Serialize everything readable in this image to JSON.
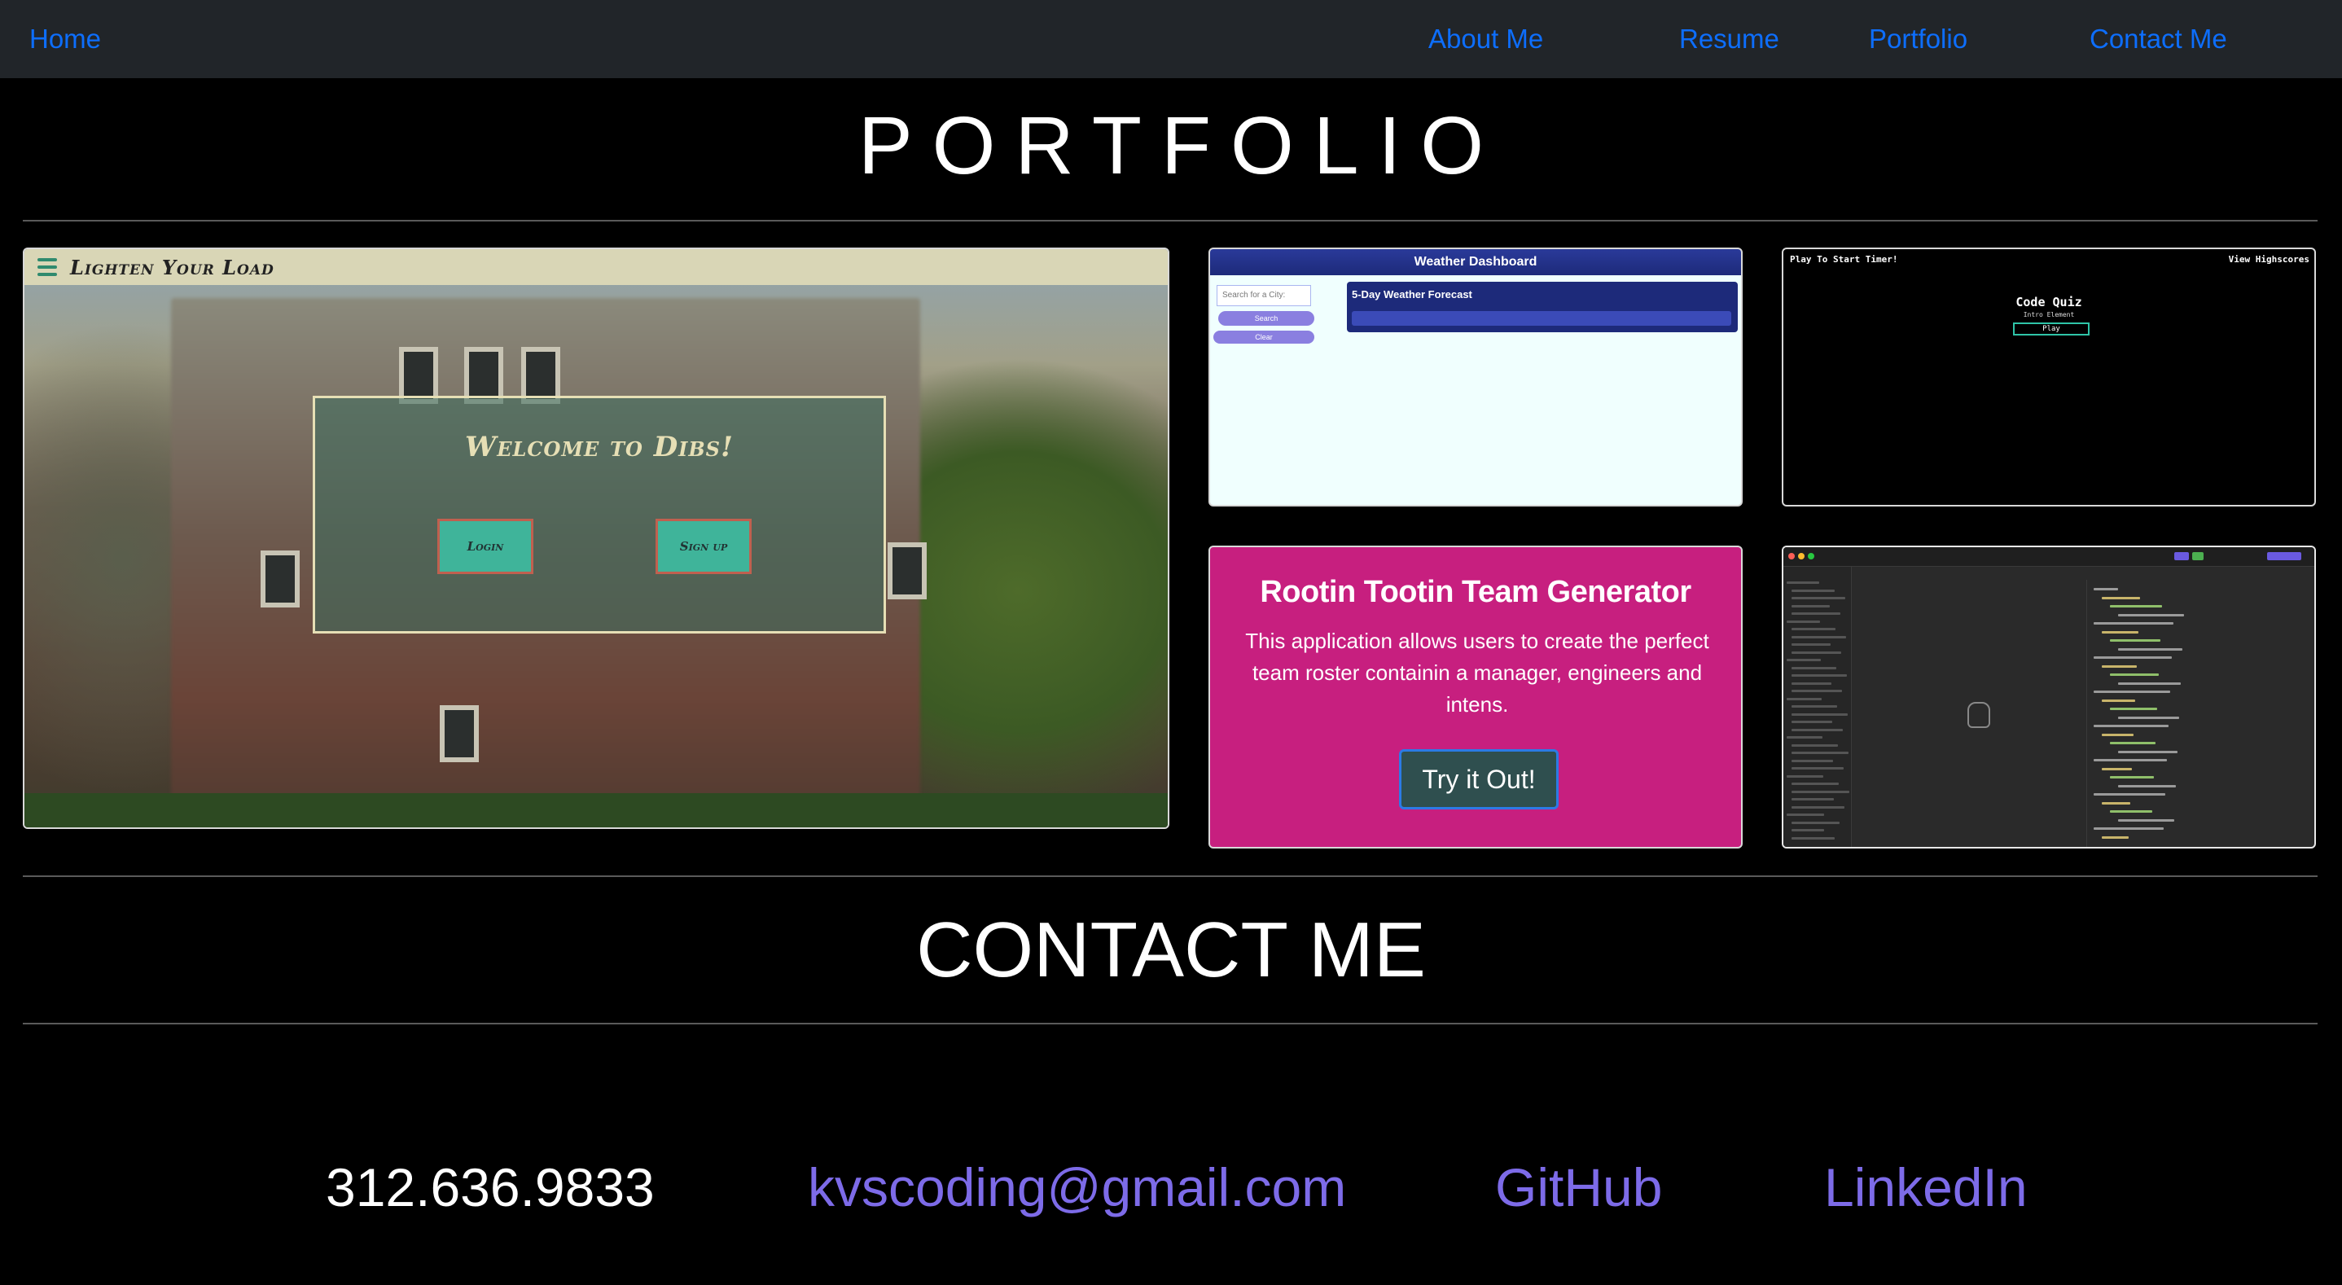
{
  "nav": {
    "home": "Home",
    "about": "About Me",
    "resume": "Resume",
    "portfolio": "Portfolio",
    "contact": "Contact Me"
  },
  "portfolio": {
    "title": "PORTFOLIO",
    "dibs": {
      "brand": "Lighten Your Load",
      "welcome": "Welcome to Dibs!",
      "login": "Login",
      "signup": "Sign up"
    },
    "weather": {
      "header": "Weather Dashboard",
      "search_placeholder": "Search for a City:",
      "search_button": "Search",
      "clear_button": "Clear",
      "forecast_label": "5-Day Weather Forecast"
    },
    "quiz": {
      "top_left": "Play To Start Timer!",
      "top_right": "View Highscores",
      "title": "Code Quiz",
      "subtitle": "Intro Element",
      "play_button": "Play"
    },
    "team": {
      "title": "Rootin Tootin Team Generator",
      "description": "This application allows users to create the perfect team roster containin a manager, engineers and intens.",
      "button": "Try it Out!"
    }
  },
  "contact": {
    "title": "CONTACT ME",
    "phone": "312.636.9833",
    "email": "kvscoding@gmail.com",
    "github": "GitHub",
    "linkedin": "LinkedIn"
  },
  "colors": {
    "nav_bg": "#212529",
    "nav_link": "#0d6efd",
    "team_card_bg": "#c71f7f",
    "contact_link": "#7d6be8"
  }
}
